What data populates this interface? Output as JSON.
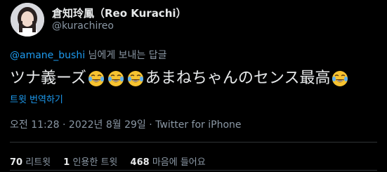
{
  "author": {
    "display_name": "倉知玲鳳（Reo Kurachi）",
    "handle": "@kurachireo"
  },
  "reply_context": {
    "mention": "@amane_bushi",
    "suffix": " 님에게 보내는 답글"
  },
  "tweet": {
    "text_part1": "ツナ義ーズ",
    "text_part2": "あまねちゃんのセンス最高",
    "emoji": "face-with-tears-of-joy-icon",
    "translate_label": "트윗 번역하기"
  },
  "meta": {
    "time": "오전 11:28",
    "separator": " · ",
    "date": "2022년 8월 29일",
    "source": "Twitter for iPhone"
  },
  "stats": {
    "retweets_count": "70",
    "retweets_label": "리트윗",
    "quotes_count": "1",
    "quotes_label": "인용한 트윗",
    "likes_count": "468",
    "likes_label": "마음에 들어요"
  },
  "colors": {
    "background": "#000000",
    "text": "#e7e9ea",
    "secondary": "#8b98a5",
    "accent": "#1d9bf0"
  }
}
